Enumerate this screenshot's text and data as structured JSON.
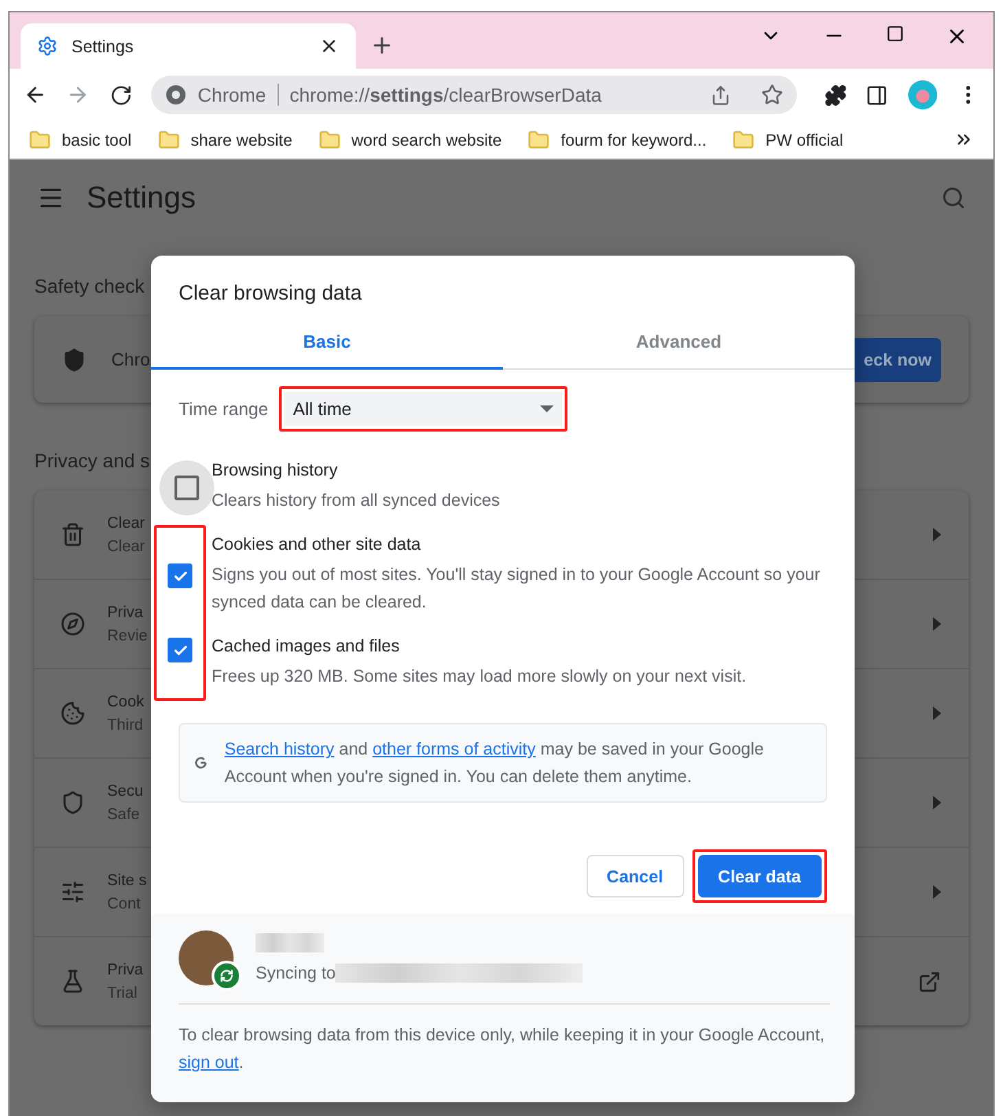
{
  "browser": {
    "tab": {
      "title": "Settings",
      "selected": true
    },
    "address": {
      "chip": "Chrome",
      "url": "chrome://**settings**/clearBrowserData"
    },
    "bookmarks": [
      "basic tool",
      "share website",
      "word search website",
      "fourm for keyword...",
      "PW official"
    ]
  },
  "settings": {
    "title": "Settings",
    "safety_title": "Safety check",
    "safety_card_text": "Chro",
    "safety_button": "eck now",
    "privacy_title": "Privacy and s",
    "items": [
      {
        "kind": "trash",
        "title": "Clear",
        "subtitle": "Clear",
        "external": false
      },
      {
        "kind": "compass",
        "title": "Priva",
        "subtitle": "Revie",
        "external": false
      },
      {
        "kind": "cookie",
        "title": "Cook",
        "subtitle": "Third",
        "external": false
      },
      {
        "kind": "shield",
        "title": "Secu",
        "subtitle": "Safe",
        "external": false
      },
      {
        "kind": "sliders",
        "title": "Site s",
        "subtitle": "Cont",
        "external": false
      },
      {
        "kind": "flask",
        "title": "Priva",
        "subtitle": "Trial",
        "external": true
      }
    ]
  },
  "dialog": {
    "title": "Clear browsing data",
    "tabs": [
      {
        "label": "Basic",
        "selected": true
      },
      {
        "label": "Advanced",
        "selected": false
      }
    ],
    "time_range": {
      "label": "Time range",
      "value": "All time",
      "highlighted": true
    },
    "options": [
      {
        "title": "Browsing history",
        "description": "Clears history from all synced devices",
        "checked": false
      },
      {
        "title": "Cookies and other site data",
        "description": "Signs you out of most sites. You'll stay signed in to your Google Account so your synced data can be cleared.",
        "checked": true
      },
      {
        "title": "Cached images and files",
        "description": "Frees up 320 MB. Some sites may load more slowly on your next visit.",
        "checked": true
      }
    ],
    "checked_highlighted": true,
    "info": [
      {
        "kind": "link",
        "text": "Search history"
      },
      {
        "kind": "text",
        "text": " and "
      },
      {
        "kind": "link",
        "text": "other forms of activity"
      },
      {
        "kind": "text",
        "text": " may be saved in your Google Account when you're signed in. You can delete them anytime."
      }
    ],
    "buttons": [
      {
        "kind": "secondary",
        "label": "Cancel",
        "highlighted": false
      },
      {
        "kind": "primary",
        "label": "Clear data",
        "highlighted": true
      }
    ],
    "sync": {
      "label": "Syncing to"
    },
    "footer": [
      {
        "kind": "text",
        "text": "To clear browsing data from this device only, while keeping it in your Google Account, "
      },
      {
        "kind": "link",
        "text": "sign out"
      },
      {
        "kind": "text",
        "text": "."
      }
    ]
  }
}
